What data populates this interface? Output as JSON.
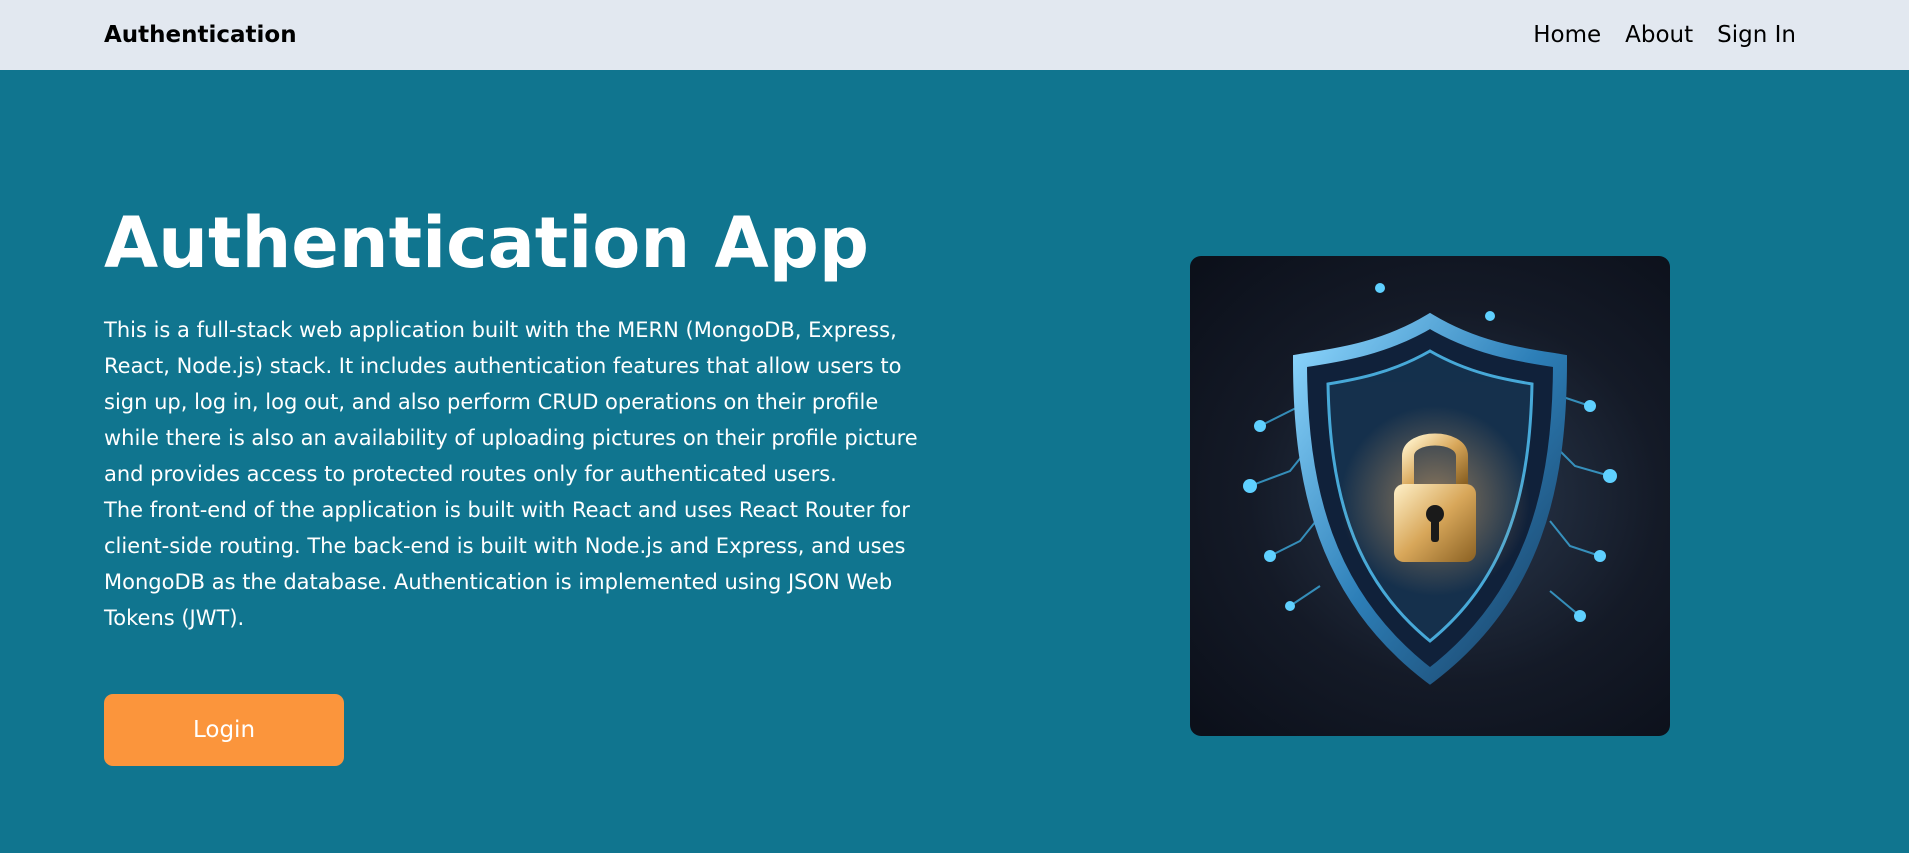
{
  "navbar": {
    "brand": "Authentication",
    "links": [
      "Home",
      "About",
      "Sign In"
    ]
  },
  "hero": {
    "title": "Authentication App",
    "paragraphs": [
      "This is a full-stack web application built with the MERN (MongoDB, Express, React, Node.js) stack. It includes authentication features that allow users to sign up, log in, log out, and also perform CRUD operations on their profile while there is also an availability of uploading pictures on their profile picture and provides access to protected routes only for authenticated users.",
      "The front-end of the application is built with React and uses React Router for client-side routing. The back-end is built with Node.js and Express, and uses MongoDB as the database. Authentication is implemented using JSON Web Tokens (JWT)."
    ],
    "login_label": "Login",
    "image_icon": "security-shield-padlock-illustration"
  },
  "colors": {
    "navbar_bg": "#e2e8f0",
    "page_bg": "#10758f",
    "button_bg": "#fb953c",
    "text_light": "#ffffff"
  }
}
